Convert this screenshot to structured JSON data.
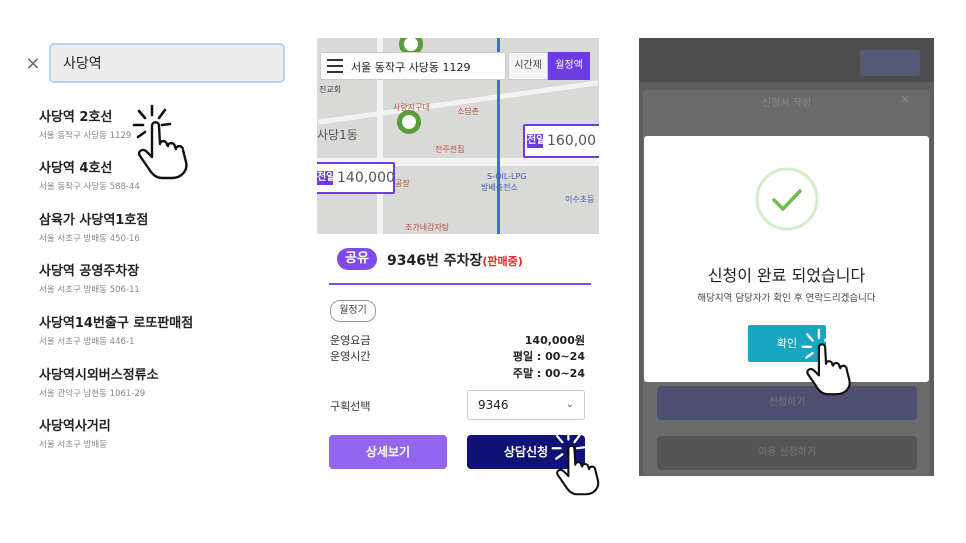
{
  "search_panel": {
    "close_glyph": "×",
    "query": "사당역",
    "results": [
      {
        "title": "사당역 2호선",
        "address": "서울 동작구 사당동 1129"
      },
      {
        "title": "사당역 4호선",
        "address": "서울 동작구 사당동 588-44"
      },
      {
        "title": "삼육가 사당역1호점",
        "address": "서울 서초구 방배동 450-16"
      },
      {
        "title": "사당역 공영주차장",
        "address": "서울 서초구 방배동 506-11"
      },
      {
        "title": "사당역14번출구 로또판매점",
        "address": "서울 서초구 방배동 446-1"
      },
      {
        "title": "사당역시외버스정류소",
        "address": "서울 관악구 남현동 1061-29"
      },
      {
        "title": "사당역사거리",
        "address": "서울 서초구 방배동"
      }
    ]
  },
  "map_panel": {
    "address": "서울 동작구 사당동 1129",
    "tab_hourly": "시간제",
    "tab_monthly": "월정액",
    "price_right": "160,00",
    "price_right_badge": "전일",
    "price_left": "140,000",
    "price_left_badge": "전일",
    "map_labels": [
      "사당1동",
      "진교회",
      "사랑지구대",
      "소담촌",
      "전주전집",
      "S-OIL-LPG",
      "방배충전소",
      "조가네감자탕",
      "이수초등",
      "공장"
    ],
    "share_chip": "공유",
    "lot_name": "9346번 주차장",
    "lot_status": "(판매중)",
    "monthly_chip": "월정기",
    "fee_label": "운영요금",
    "fee_value": "140,000원",
    "hours_label": "운영시간",
    "hours_weekday": "평일 : 00~24",
    "hours_weekend": "주말 : 00~24",
    "section_label": "구획선택",
    "section_value": "9346",
    "detail_button": "상세보기",
    "consult_button": "상담신청"
  },
  "modal_panel": {
    "bg_title": "신청서 작성",
    "bg_close": "×",
    "bg_button1": "신청하기",
    "bg_button2": "이용 신청하기",
    "title": "신청이 완료 되었습니다",
    "message": "해당지역 담당자가 확인 후 연락드리겠습니다",
    "ok_button": "확인"
  },
  "colors": {
    "purple": "#7e4be8",
    "navy": "#0f1277",
    "teal": "#18a6c0",
    "check_green": "#6cc04a",
    "status_red": "#e02a2a"
  }
}
